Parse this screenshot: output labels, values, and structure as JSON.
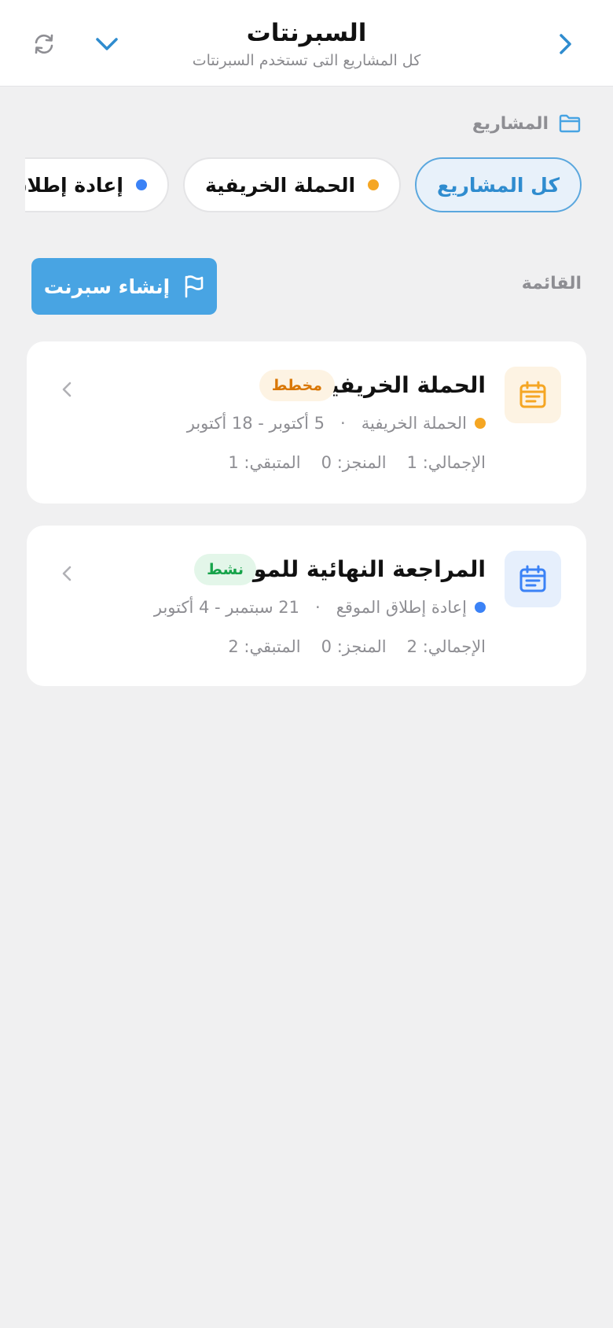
{
  "header": {
    "title": "السبرنتات",
    "subtitle": "كل المشاريع التى تستخدم السبرنتات",
    "back_icon": "chevron-right-icon",
    "dropdown_icon": "chevron-down-icon",
    "refresh_icon": "refresh-icon"
  },
  "projects_section": {
    "label": "المشاريع",
    "icon": "folder-icon"
  },
  "chips": [
    {
      "label": "كل المشاريع",
      "active": true
    },
    {
      "label": "الحملة الخريفية",
      "dot_color": "#f5a623"
    },
    {
      "label": "إعادة إطلاق الموقع",
      "dot_color": "#3b82f6"
    }
  ],
  "list": {
    "label": "القائمة",
    "create_button": "إنشاء سبرنت",
    "create_icon": "flag-icon"
  },
  "sprints": [
    {
      "name": "الحملة الخريفية",
      "badge": "مخطط",
      "badge_color": "#d97706",
      "project": "الحملة الخريفية",
      "project_dot": "#f5a623",
      "dates": "5 أكتوبر - 18 أكتوبر",
      "total": "الإجمالي: 1",
      "done": "المنجز: 0",
      "remaining": "المتبقي: 1",
      "icon": "calendar-icon",
      "icon_color": "#f5a623"
    },
    {
      "name": "المراجعة النهائية للموقع",
      "badge": "نشط",
      "badge_color": "#16a34a",
      "project": "إعادة إطلاق الموقع",
      "project_dot": "#3b82f6",
      "dates": "21 سبتمبر - 4 أكتوبر",
      "total": "الإجمالي: 2",
      "done": "المنجز: 0",
      "remaining": "المتبقي: 2",
      "icon": "calendar-icon",
      "icon_color": "#3b82f6"
    }
  ]
}
